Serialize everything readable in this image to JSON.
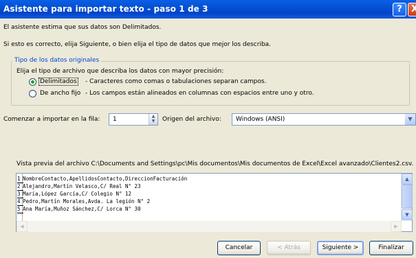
{
  "window": {
    "title": "Asistente para importar texto - paso 1 de 3",
    "help_glyph": "?",
    "close_glyph": "X"
  },
  "intro": {
    "line1": "El asistente estima que sus datos son Delimitados.",
    "line2": "Si esto es correcto, elija Siguiente, o bien elija el tipo de datos que mejor los describa."
  },
  "original_type": {
    "legend": "Tipo de los datos originales",
    "prompt": "Elija el tipo de archivo que describa los datos con mayor precisión:",
    "options": [
      {
        "label": "Delimitados",
        "description": "- Caracteres como comas o tabulaciones separan campos.",
        "selected": true
      },
      {
        "label": "De ancho fijo",
        "description": "- Los campos están alineados en columnas con espacios entre uno y otro.",
        "selected": false
      }
    ]
  },
  "start_row": {
    "label": "Comenzar a importar en la fila:",
    "value": "1"
  },
  "origin": {
    "label": "Origen del archivo:",
    "value": "Windows (ANSI)"
  },
  "preview": {
    "label": "Vista previa del archivo C:\\Documents and Settings\\pc\\Mis documentos\\Mis documentos de Excel\\Excel avanzado\\Clientes2.csv.",
    "rows": [
      {
        "num": "1",
        "text": "NombreContacto,ApellidosContacto,DireccionFacturación"
      },
      {
        "num": "2",
        "text": "Alejandro,Martín Velasco,C/ Real N° 23"
      },
      {
        "num": "3",
        "text": "María,López García,C/ Colegio N° 12"
      },
      {
        "num": "4",
        "text": "Pedro,Martín Morales,Avda. La legión N° 2"
      },
      {
        "num": "5",
        "text": "Ana María,Muñoz Sánchez,C/ Lorca N° 30"
      }
    ]
  },
  "buttons": {
    "cancel": "Cancelar",
    "back": "< Atrás",
    "next": "Siguiente >",
    "finish": "Finalizar"
  }
}
